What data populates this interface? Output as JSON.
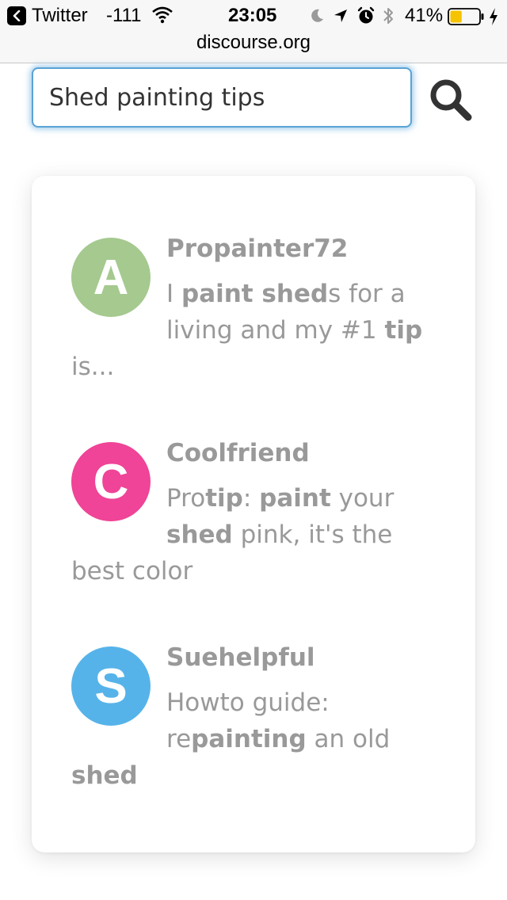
{
  "status_bar": {
    "back_app": "Twitter",
    "signal": "-111",
    "time": "23:05",
    "battery_percent": "41%",
    "battery_level": 0.41,
    "battery_color": "#f5c300"
  },
  "url_bar": {
    "domain": "discourse.org"
  },
  "search": {
    "value": "Shed painting tips",
    "button_icon": "magnifier-icon"
  },
  "results": [
    {
      "username": "Propainter72",
      "avatar_letter": "A",
      "avatar_color": "#a5c98f",
      "excerpt": [
        {
          "t": "I ",
          "b": false
        },
        {
          "t": "paint shed",
          "b": true
        },
        {
          "t": "s for a living and my #1 ",
          "b": false
        },
        {
          "t": "tip",
          "b": true
        },
        {
          "t": " is...",
          "b": false
        }
      ]
    },
    {
      "username": "Coolfriend",
      "avatar_letter": "C",
      "avatar_color": "#ef4497",
      "excerpt": [
        {
          "t": "Pro",
          "b": false
        },
        {
          "t": "tip",
          "b": true
        },
        {
          "t": ": ",
          "b": false
        },
        {
          "t": "paint",
          "b": true
        },
        {
          "t": " your ",
          "b": false
        },
        {
          "t": "shed",
          "b": true
        },
        {
          "t": " pink, it's the best color",
          "b": false
        }
      ]
    },
    {
      "username": "Suehelpful",
      "avatar_letter": "S",
      "avatar_color": "#56b3e9",
      "excerpt": [
        {
          "t": "Howto guide: re",
          "b": false
        },
        {
          "t": "painting",
          "b": true
        },
        {
          "t": " an old ",
          "b": false
        },
        {
          "t": "shed",
          "b": true
        }
      ]
    }
  ]
}
